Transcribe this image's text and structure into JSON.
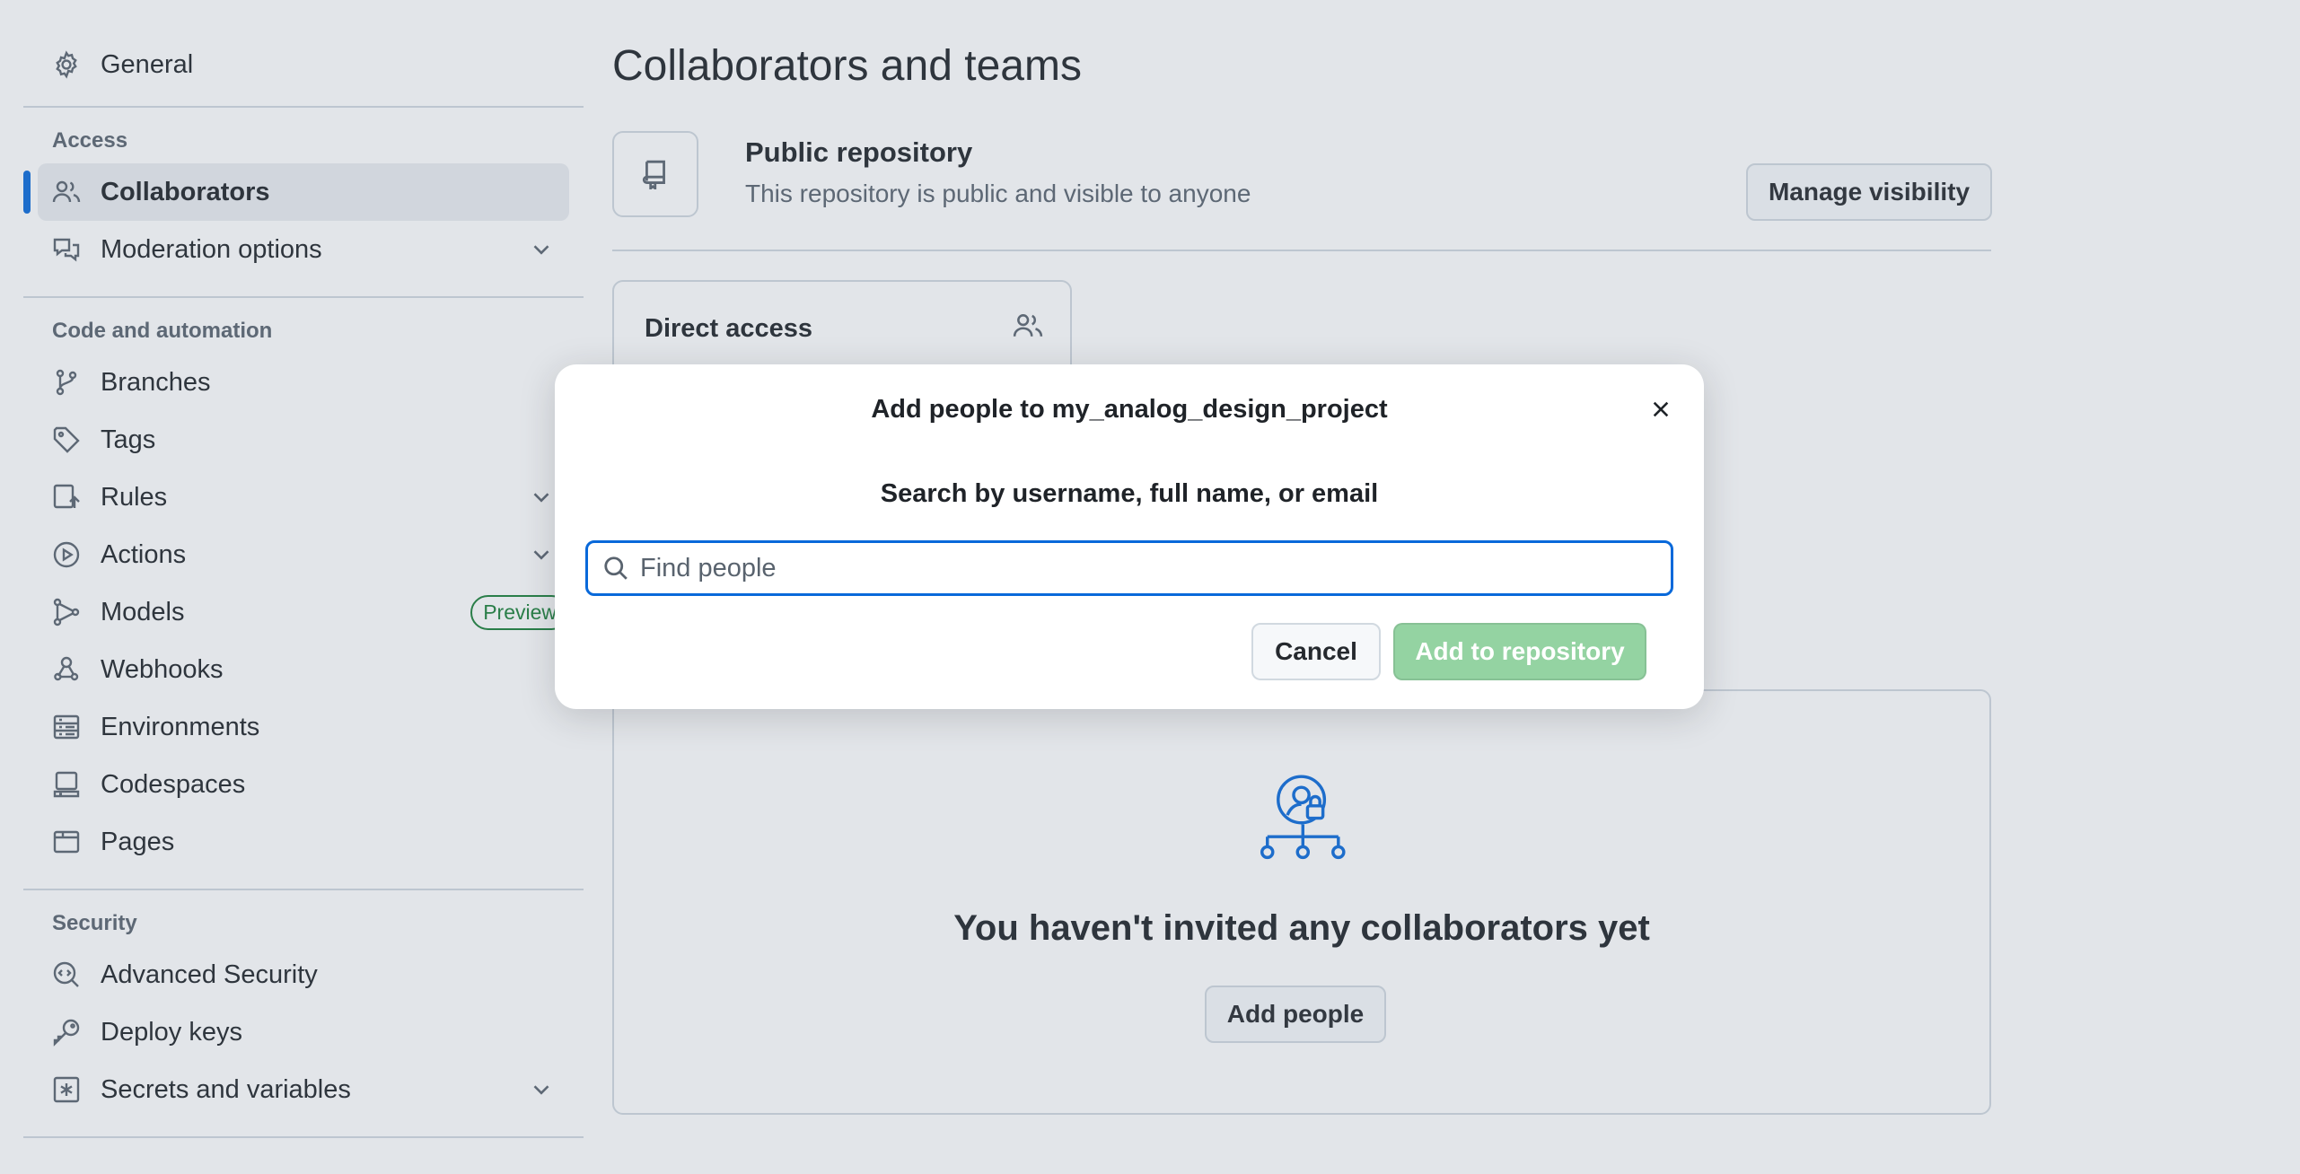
{
  "sidebar": {
    "general": "General",
    "sections": {
      "access": "Access",
      "code": "Code and automation",
      "security": "Security"
    },
    "access_items": {
      "collaborators": "Collaborators",
      "moderation": "Moderation options"
    },
    "code_items": {
      "branches": "Branches",
      "tags": "Tags",
      "rules": "Rules",
      "actions": "Actions",
      "models": "Models",
      "models_badge": "Preview",
      "webhooks": "Webhooks",
      "environments": "Environments",
      "codespaces": "Codespaces",
      "pages": "Pages"
    },
    "security_items": {
      "advanced_security": "Advanced Security",
      "deploy_keys": "Deploy keys",
      "secrets": "Secrets and variables"
    }
  },
  "main": {
    "title": "Collaborators and teams",
    "repo": {
      "title": "Public repository",
      "subtitle": "This repository is public and visible to anyone",
      "manage_button": "Manage visibility"
    },
    "direct_access": "Direct access",
    "empty": {
      "title": "You haven't invited any collaborators yet",
      "add_button": "Add people"
    }
  },
  "dialog": {
    "title": "Add people to my_analog_design_project",
    "label": "Search by username, full name, or email",
    "search": {
      "value": "",
      "placeholder": "Find people"
    },
    "cancel": "Cancel",
    "submit": "Add to repository"
  },
  "colors": {
    "accent": "#0969da",
    "success": "#1a7f37",
    "success_disabled": "#94d3a2",
    "border": "#d1d9e0"
  }
}
